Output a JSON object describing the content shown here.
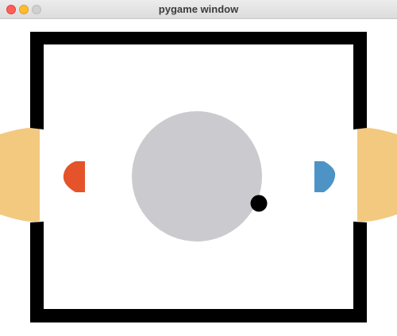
{
  "window": {
    "title": "pygame window"
  },
  "colors": {
    "wall": "#000000",
    "field": "#ffffff",
    "center_circle": "#cbcbcf",
    "goal_area": "#f2c97f",
    "player_left": "#e4532a",
    "player_right": "#4e93c6",
    "puck": "#000000",
    "close_button": "#ff5f57",
    "minimize_button": "#febc2e",
    "maximize_button": "#d0d0d0"
  },
  "icons": {
    "close": "close-icon",
    "minimize": "minimize-icon",
    "maximize": "maximize-icon"
  }
}
